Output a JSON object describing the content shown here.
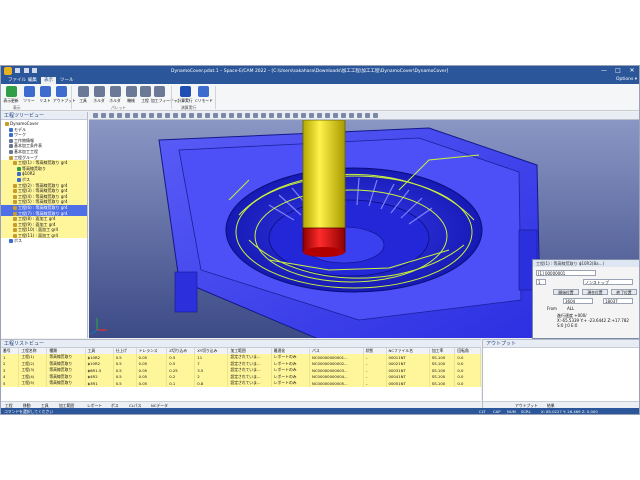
{
  "window": {
    "title": "DynamoCover.pdat.1 – Space-E/CAM 2022 – [C:\\Users\\sakahara\\Downloads\\加工工程\\加工工程\\DynamoCover\\DynamoCover]",
    "controls": [
      "—",
      "□",
      "✕"
    ]
  },
  "menu": {
    "tabs": [
      "ファイル",
      "編集",
      "表示",
      "ツール"
    ],
    "active_index": 2,
    "options_label": "Options ▾"
  },
  "ribbon": {
    "buttons": [
      {
        "label": "表示更新",
        "icon": "refresh-icon",
        "color": "#2f9e44"
      },
      {
        "label": "ツリー",
        "icon": "tree-icon",
        "color": "#3d6ccf"
      },
      {
        "label": "リスト",
        "icon": "list-icon",
        "color": "#3d6ccf"
      },
      {
        "label": "アウトプット",
        "icon": "output-icon",
        "color": "#3d6ccf"
      },
      {
        "label": "工具",
        "icon": "tool-icon",
        "color": "#6a7a96"
      },
      {
        "label": "ホルダ",
        "icon": "holder-icon",
        "color": "#6a7a96"
      },
      {
        "label": "ホルダ",
        "icon": "holder-icon",
        "color": "#6a7a96"
      },
      {
        "label": "機械",
        "icon": "machine-icon",
        "color": "#6a7a96"
      },
      {
        "label": "工程",
        "icon": "process-icon",
        "color": "#6a7a96"
      },
      {
        "label": "加工フィーチャ",
        "icon": "feature-icon",
        "color": "#6a7a96"
      },
      {
        "label": "計算実行",
        "icon": "play-icon",
        "color": "#1f4fb5"
      },
      {
        "label": "Cリモード",
        "icon": "gear-icon",
        "color": "#3d6ccf"
      }
    ],
    "groups": [
      "表示",
      "パレット",
      "演算実行"
    ]
  },
  "left_panel": {
    "title": "工程ツリービュー",
    "items": [
      {
        "label": "DynamoCover",
        "indent": 1,
        "style": "normal",
        "color": "#c89b2a"
      },
      {
        "label": "モデル",
        "indent": 2,
        "style": "normal",
        "color": "#3d6ccf"
      },
      {
        "label": "ワーク",
        "indent": 2,
        "style": "normal",
        "color": "#3d6ccf"
      },
      {
        "label": "工作物情報",
        "indent": 2,
        "style": "normal",
        "color": "#6a7a96"
      },
      {
        "label": "基本加工条件表",
        "indent": 2,
        "style": "normal",
        "color": "#6a7a96"
      },
      {
        "label": "基本加工工程",
        "indent": 2,
        "style": "normal",
        "color": "#6a7a96"
      },
      {
        "label": "工程グループ",
        "indent": 2,
        "style": "normal",
        "color": "#c89b2a"
      },
      {
        "label": "工程(1) : 等高線荒取り gr4",
        "indent": 3,
        "style": "hl",
        "color": "#c89b2a"
      },
      {
        "label": "等高線荒取り",
        "indent": 4,
        "style": "hl",
        "color": "#2f9e44"
      },
      {
        "label": "ϕ10R2",
        "indent": 4,
        "style": "hl",
        "color": "#3d6ccf"
      },
      {
        "label": "ボス",
        "indent": 4,
        "style": "hl",
        "color": "#3d6ccf"
      },
      {
        "label": "工程(2) : 等高線荒取り gr4",
        "indent": 3,
        "style": "hl",
        "color": "#c89b2a"
      },
      {
        "label": "工程(3) : 等高線荒取り gr4",
        "indent": 3,
        "style": "hl",
        "color": "#c89b2a"
      },
      {
        "label": "工程(4) : 等高線荒取り gr4",
        "indent": 3,
        "style": "hl",
        "color": "#c89b2a"
      },
      {
        "label": "工程(5) : 等高線荒取り gr4",
        "indent": 3,
        "style": "hl",
        "color": "#c89b2a"
      },
      {
        "label": "工程(6) : 等高線荒取り gr4",
        "indent": 3,
        "style": "sel",
        "color": "#c89b2a"
      },
      {
        "label": "工程(7) : 等高線荒取り gr4",
        "indent": 3,
        "style": "sel",
        "color": "#c89b2a"
      },
      {
        "label": "工程(8) : 面加工 gr4",
        "indent": 3,
        "style": "hl",
        "color": "#c89b2a"
      },
      {
        "label": "工程(9) : 面加工 gr4",
        "indent": 3,
        "style": "hl",
        "color": "#c89b2a"
      },
      {
        "label": "工程(10) : 面加工 gr4",
        "indent": 3,
        "style": "hl",
        "color": "#c89b2a"
      },
      {
        "label": "工程(11) : 面加工 gr4",
        "indent": 3,
        "style": "hl",
        "color": "#c89b2a"
      },
      {
        "label": "ボス",
        "indent": 2,
        "style": "normal",
        "color": "#3d6ccf"
      }
    ]
  },
  "viewport": {
    "background": "#5d6fb0",
    "part_color": "#3b3ff5",
    "toolpath_color": "#c9f23a"
  },
  "float_dialog": {
    "title": "工程(1) : 等高線荒取り ϕ10R2(Ba...)",
    "dropdown_value": "[1] 00000001",
    "mode_value": "ノンストップ",
    "step_value": "1",
    "btn_start": "開始位置",
    "btn_current": "現在位置",
    "btn_end": "終了位置",
    "count_a": "3604",
    "count_b": "18037",
    "from_label": "From",
    "all_label": "ALL",
    "info_lines": [
      "進行速度 +000/",
      "X:-65.5339 Y:+ -23.6442 Z:+17.782",
      "S:0 J:0 E:0"
    ]
  },
  "op_list": {
    "title": "工程リストビュー",
    "columns": [
      "番号",
      "工程名称",
      "種類",
      "工具",
      "仕上げ",
      "トレランス",
      "Z切り込み",
      "XY切り込み",
      "加工範囲",
      "最適化",
      "パス",
      "状態",
      "NCファイル名",
      "加工率",
      "回転角"
    ],
    "rows": [
      [
        "1",
        "工程(1)",
        "等高線荒取り",
        "ϕ10R2",
        "0.5",
        "0.05",
        "0.5",
        "11",
        "設定されていま...",
        "レポートのみ",
        "NC00000000001...",
        "–",
        "00011NT",
        "SS.100",
        "0.0"
      ],
      [
        "2",
        "工程(2)",
        "等高線荒取り",
        "ϕ10R2",
        "0.5",
        "0.05",
        "0.5",
        "7",
        "設定されていま...",
        "レポートのみ",
        "NC00000000002...",
        "–",
        "00021NT",
        "SS.100",
        "0.0"
      ],
      [
        "3",
        "工程(3)",
        "等高線荒取り",
        "ϕ6R1.5",
        "0.5",
        "0.05",
        "0.25",
        "3.5",
        "設定されていま...",
        "レポートのみ",
        "NC00000000003...",
        "–",
        "00031NT",
        "SS.100",
        "0.0"
      ],
      [
        "4",
        "工程(4)",
        "等高線荒取り",
        "ϕ4R2",
        "0.5",
        "0.05",
        "0.2",
        "2",
        "設定されていま...",
        "レポートのみ",
        "NC00000000004...",
        "–",
        "00041NT",
        "SS.100",
        "0.0"
      ],
      [
        "5",
        "工程(5)",
        "等高線荒取り",
        "ϕ3R1",
        "0.5",
        "0.05",
        "0.1",
        "0.8",
        "設定されていま...",
        "レポートのみ",
        "NC00000000005...",
        "–",
        "00051NT",
        "SS.100",
        "0.0"
      ]
    ],
    "bottom_tabs": [
      "工程",
      "移動",
      "工具",
      "加工範囲",
      "レポート",
      "ボス",
      "CLパス",
      "NCデータ"
    ]
  },
  "output_panel": {
    "title": "アウトプット",
    "tabs": [
      "アウトプット",
      "結果"
    ]
  },
  "statusbar": {
    "left": "コマンドを選択してください",
    "right_items": [
      "CLT",
      "CAP",
      "NUM",
      "SCRL",
      "X: 85.0227  Y: 26.469  Z: 0.000"
    ]
  }
}
